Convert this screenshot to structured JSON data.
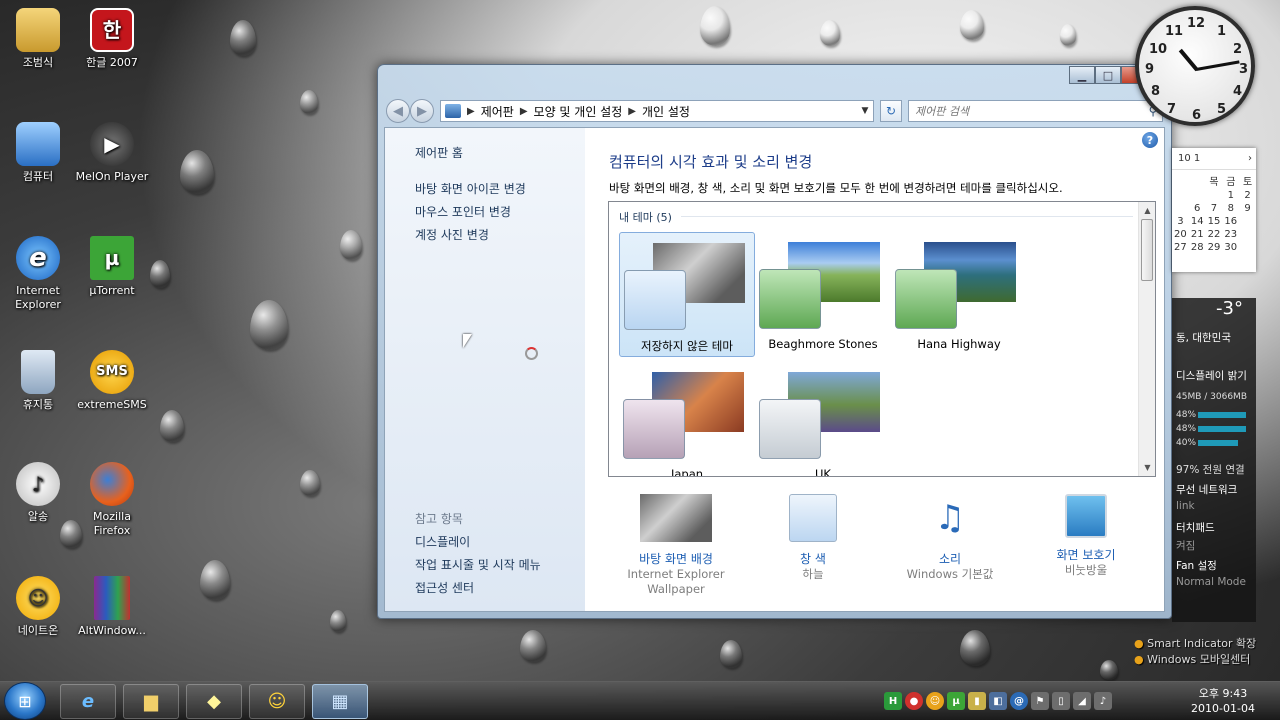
{
  "desktop": {
    "icons": [
      {
        "label": "조범식"
      },
      {
        "label": "한글 2007"
      },
      {
        "label": "컴퓨터"
      },
      {
        "label": "MelOn Player"
      },
      {
        "label": "Internet Explorer"
      },
      {
        "label": "µTorrent"
      },
      {
        "label": "휴지통"
      },
      {
        "label": "extremeSMS"
      },
      {
        "label": "알송"
      },
      {
        "label": "Mozilla Firefox"
      },
      {
        "label": "네이트온"
      },
      {
        "label": "AltWindow..."
      }
    ],
    "icon_glyphs": {
      "hangul": "한",
      "sms": "SMS",
      "utorrent": "µ",
      "ie": "e"
    }
  },
  "window": {
    "address": {
      "crumbs": [
        "제어판",
        "모양 및 개인 설정",
        "개인 설정"
      ]
    },
    "search": {
      "placeholder": "제어판 검색"
    },
    "left_pane": {
      "home": "제어판 홈",
      "links": [
        "바탕 화면 아이콘 변경",
        "마우스 포인터 변경",
        "계정 사진 변경"
      ],
      "see_also_label": "참고 항목",
      "see_also": [
        "디스플레이",
        "작업 표시줄 및 시작 메뉴",
        "접근성 센터"
      ]
    },
    "main": {
      "title": "컴퓨터의 시각 효과 및 소리 변경",
      "description": "바탕 화면의 배경, 창 색, 소리 및 화면 보호기를 모두 한 번에 변경하려면 테마를 클릭하십시오.",
      "group_label": "내 테마 (5)",
      "themes": [
        {
          "name": "저장하지 않은 테마",
          "selected": true
        },
        {
          "name": "Beaghmore Stones",
          "selected": false
        },
        {
          "name": "Hana Highway",
          "selected": false
        },
        {
          "name": "Japan",
          "selected": false
        },
        {
          "name": "UK",
          "selected": false
        }
      ],
      "bottom": [
        {
          "label": "바탕 화면 배경",
          "sub": "Internet Explorer Wallpaper"
        },
        {
          "label": "창 색",
          "sub": "하늘"
        },
        {
          "label": "소리",
          "sub": "Windows 기본값"
        },
        {
          "label": "화면 보호기",
          "sub": "비눗방울"
        }
      ]
    }
  },
  "gadgets": {
    "clock_numbers": [
      "12",
      "1",
      "2",
      "3",
      "4",
      "5",
      "6",
      "7",
      "8",
      "9",
      "10",
      "11"
    ],
    "calendar": {
      "header": "10 1",
      "days_header": [
        "",
        "",
        "목",
        "금",
        "토"
      ],
      "cells": [
        "",
        "",
        "",
        "1",
        "2",
        "",
        "6",
        "7",
        "8",
        "9",
        "3",
        "14",
        "15",
        "16",
        "",
        "20",
        "21",
        "22",
        "23",
        "",
        "27",
        "28",
        "29",
        "30"
      ]
    },
    "weather_temp": "-3°",
    "weather_loc": "동, 대한민국",
    "panel_rows": [
      "디스플레이 밝기",
      "45MB / 3066MB",
      "48%",
      "48%",
      "40%",
      "97% 전원 연결",
      "무선 네트워크",
      "link",
      "터치패드",
      "켜짐",
      "Fan 설정",
      "Normal Mode"
    ],
    "smart_links": [
      "Smart Indicator 확장",
      "Windows 모바일센터"
    ]
  },
  "taskbar": {
    "time": "오후 9:43",
    "date": "2010-01-04"
  }
}
